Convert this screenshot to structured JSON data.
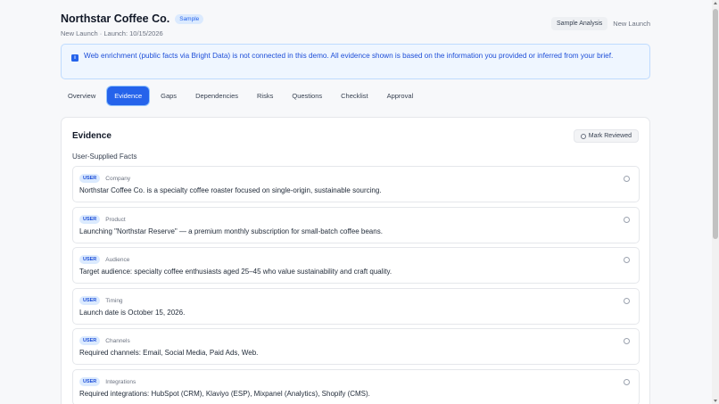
{
  "header": {
    "title": "Northstar Coffee Co.",
    "badge": "Sample",
    "subtitle": "New Launch · Launch: 10/15/2026",
    "actions": {
      "sample_analysis": "Sample Analysis",
      "new_launch": "New Launch"
    }
  },
  "banner": {
    "icon": "info-icon",
    "text": "Web enrichment (public facts via Bright Data) is not connected in this demo. All evidence shown is based on the information you provided or inferred from your brief."
  },
  "tabs": [
    {
      "label": "Overview",
      "active": false
    },
    {
      "label": "Evidence",
      "active": true
    },
    {
      "label": "Gaps",
      "active": false
    },
    {
      "label": "Dependencies",
      "active": false
    },
    {
      "label": "Risks",
      "active": false
    },
    {
      "label": "Questions",
      "active": false
    },
    {
      "label": "Checklist",
      "active": false
    },
    {
      "label": "Approval",
      "active": false
    }
  ],
  "evidence": {
    "title": "Evidence",
    "mark_reviewed": "Mark Reviewed",
    "section_label": "User-Supplied Facts",
    "facts": [
      {
        "source": "USER",
        "category": "Company",
        "text": "Northstar Coffee Co. is a specialty coffee roaster focused on single-origin, sustainable sourcing."
      },
      {
        "source": "USER",
        "category": "Product",
        "text": "Launching \"Northstar Reserve\" — a premium monthly subscription for small-batch coffee beans."
      },
      {
        "source": "USER",
        "category": "Audience",
        "text": "Target audience: specialty coffee enthusiasts aged 25–45 who value sustainability and craft quality."
      },
      {
        "source": "USER",
        "category": "Timing",
        "text": "Launch date is October 15, 2026."
      },
      {
        "source": "USER",
        "category": "Channels",
        "text": "Required channels: Email, Social Media, Paid Ads, Web."
      },
      {
        "source": "USER",
        "category": "Integrations",
        "text": "Required integrations: HubSpot (CRM), Klaviyo (ESP), Mixpanel (Analytics), Shopify (CMS)."
      }
    ]
  }
}
